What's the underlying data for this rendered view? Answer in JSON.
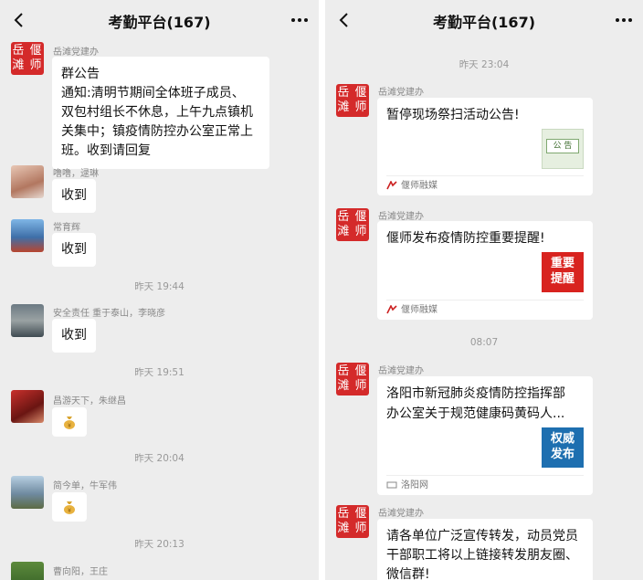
{
  "app": {
    "title": "考勤平台(167)"
  },
  "left": {
    "announcement": {
      "sender": "岳滩党建办",
      "heading": "群公告",
      "lines": [
        "通知:清明节期间全体班子成员、",
        "双包村组长不休息，上午九点镇机",
        "关集中；镇疫情防控办公室正常上",
        "班。收到请回复"
      ]
    },
    "messages": [
      {
        "sender": "噜噜，逯琳",
        "text": "收到"
      },
      {
        "sender": "常育辉",
        "text": "收到"
      },
      {
        "time": "昨天 19:44"
      },
      {
        "sender": "安全责任 重于泰山，李晓彦",
        "text": "收到"
      },
      {
        "time": "昨天 19:51"
      },
      {
        "sender": "昌游天下，朱继昌"
      },
      {
        "time": "昨天 20:04"
      },
      {
        "sender": "简今单，牛军伟"
      },
      {
        "time": "昨天 20:13"
      },
      {
        "sender": "曹向阳，王庄"
      }
    ]
  },
  "right": {
    "time_top": "昨天 23:04",
    "cards": [
      {
        "sender": "岳滩党建办",
        "title": "暂停现场祭扫活动公告!",
        "thumb": "公 告",
        "source": "偃师融媒"
      },
      {
        "sender": "岳滩党建办",
        "title": "偃师发布疫情防控重要提醒!",
        "thumb_lines": [
          "重要",
          "提醒"
        ],
        "source": "偃师融媒"
      },
      {
        "sender": "岳滩党建办",
        "title_lines": [
          "洛阳市新冠肺炎疫情防控指挥部",
          "办公室关于规范健康码黄码人..."
        ],
        "thumb_lines": [
          "权威",
          "发布"
        ],
        "source": "洛阳网"
      }
    ],
    "time_mid": "08:07",
    "last": {
      "sender": "岳滩党建办",
      "lines": [
        "请各单位广泛宣传转发，动员党员",
        "干部职工将以上链接转发朋友圈、",
        "微信群!"
      ]
    },
    "avatar_text": [
      "岳 偃",
      "滩 师"
    ]
  }
}
